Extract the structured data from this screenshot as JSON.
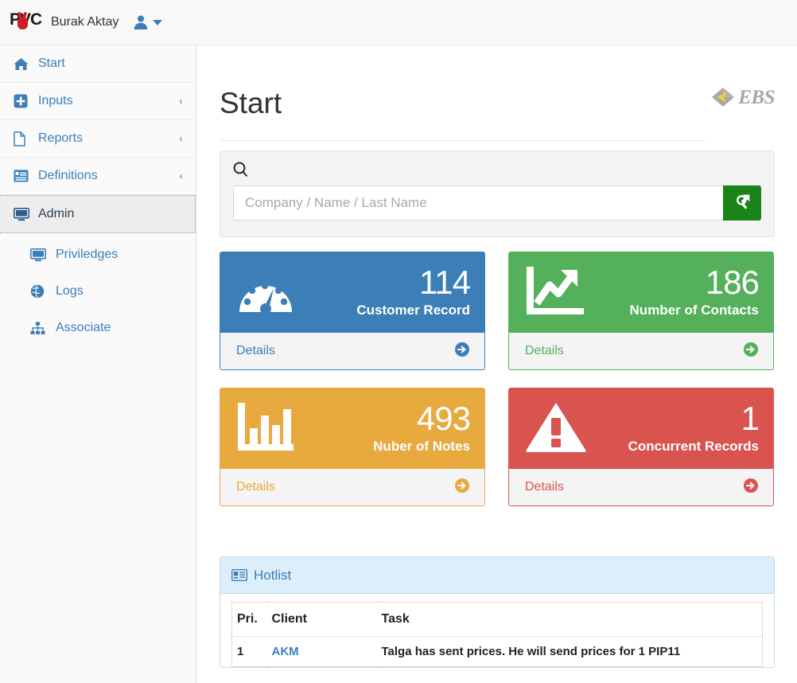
{
  "topbar": {
    "logo_text": "PVC",
    "logo_icon": "hand-victory-icon",
    "user_name": "Burak Aktay",
    "user_icon": "user-icon",
    "caret_icon": "caret-down-icon"
  },
  "sidebar": {
    "items": [
      {
        "label": "Start",
        "icon": "home-icon",
        "chevron": "",
        "active": false
      },
      {
        "label": "Inputs",
        "icon": "plus-square-icon",
        "chevron": "‹",
        "active": false
      },
      {
        "label": "Reports",
        "icon": "file-icon",
        "chevron": "‹",
        "active": false
      },
      {
        "label": "Definitions",
        "icon": "list-alt-icon",
        "chevron": "‹",
        "active": false
      },
      {
        "label": "Admin",
        "icon": "desktop-icon",
        "chevron": "",
        "active": true
      }
    ],
    "subitems": [
      {
        "label": "Priviledges",
        "icon": "desktop-icon"
      },
      {
        "label": "Logs",
        "icon": "globe-icon"
      },
      {
        "label": "Associate",
        "icon": "sitemap-icon"
      }
    ]
  },
  "page": {
    "title": "Start",
    "brand_mark": "ebs-diamond-icon",
    "brand_text": "EBS"
  },
  "search": {
    "icon": "search-icon",
    "placeholder": "Company / Name / Last Name",
    "value": "",
    "button_icon": "search-arrow-icon",
    "button_color": "#1b8419"
  },
  "cards": [
    {
      "value": "114",
      "label": "Customer Record",
      "details_label": "Details",
      "icon": "tachometer-icon",
      "arrow_icon": "arrow-circle-right-icon",
      "color": "#3c7eb8"
    },
    {
      "value": "186",
      "label": "Number of Contacts",
      "details_label": "Details",
      "icon": "line-chart-icon",
      "arrow_icon": "arrow-circle-right-icon",
      "color": "#54b05a"
    },
    {
      "value": "493",
      "label": "Nuber of Notes",
      "details_label": "Details",
      "icon": "bar-chart-icon",
      "arrow_icon": "arrow-circle-right-icon",
      "color": "#e8a93f"
    },
    {
      "value": "1",
      "label": "Concurrent Records",
      "details_label": "Details",
      "icon": "warning-triangle-icon",
      "arrow_icon": "arrow-circle-right-icon",
      "color": "#d9534f"
    }
  ],
  "hotlist": {
    "title": "Hotlist",
    "icon": "vcard-icon",
    "columns": [
      "Pri.",
      "Client",
      "Task"
    ],
    "rows": [
      {
        "pri": "1",
        "client": "AKM",
        "task": "Talga has sent prices. He will send prices for 1 PIP11"
      }
    ]
  }
}
